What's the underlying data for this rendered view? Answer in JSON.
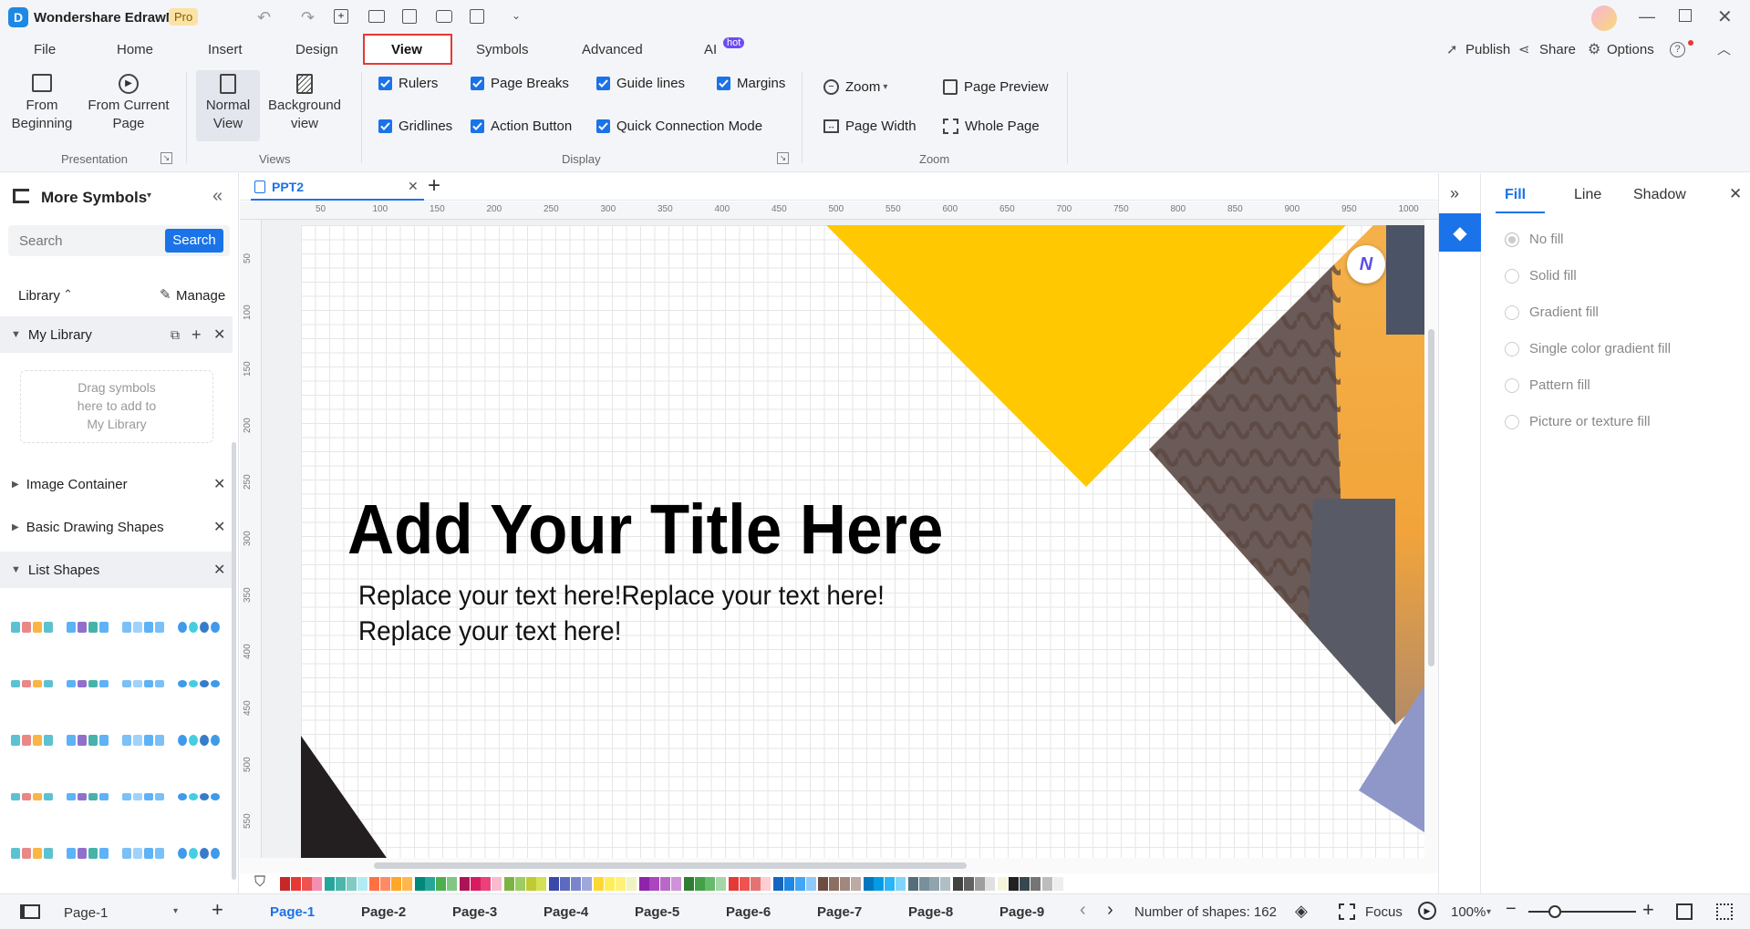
{
  "app": {
    "title": "Wondershare EdrawMax",
    "badge": "Pro"
  },
  "menu": {
    "tabs": [
      "File",
      "Home",
      "Insert",
      "Design",
      "View",
      "Symbols",
      "Advanced",
      "AI"
    ],
    "active": "View",
    "ai_badge": "hot",
    "right": {
      "publish": "Publish",
      "share": "Share",
      "options": "Options"
    }
  },
  "ribbon": {
    "presentation": {
      "from_beginning": [
        "From",
        "Beginning"
      ],
      "from_current": [
        "From Current",
        "Page"
      ],
      "label": "Presentation"
    },
    "views": {
      "normal": [
        "Normal",
        "View"
      ],
      "background": [
        "Background",
        "view"
      ],
      "label": "Views"
    },
    "display": {
      "rulers": "Rulers",
      "page_breaks": "Page Breaks",
      "guide_lines": "Guide lines",
      "margins": "Margins",
      "gridlines": "Gridlines",
      "action_button": "Action Button",
      "quick_connection": "Quick Connection Mode",
      "label": "Display"
    },
    "zoom": {
      "zoom": "Zoom",
      "page_width": "Page Width",
      "page_preview": "Page Preview",
      "whole_page": "Whole Page",
      "label": "Zoom"
    }
  },
  "left_panel": {
    "title": "More Symbols",
    "search_placeholder": "Search",
    "search_button": "Search",
    "library": "Library",
    "manage": "Manage",
    "my_library": "My Library",
    "drag_hint": [
      "Drag symbols",
      "here to add to",
      "My Library"
    ],
    "sections": [
      "Image Container",
      "Basic Drawing Shapes",
      "List Shapes"
    ]
  },
  "doc_tab": {
    "name": "PPT2"
  },
  "ruler": {
    "h": [
      "50",
      "100",
      "150",
      "200",
      "250",
      "300",
      "350",
      "400",
      "450",
      "500",
      "550",
      "600",
      "650",
      "700",
      "750",
      "800",
      "850",
      "900",
      "950",
      "1000"
    ],
    "v": [
      "50",
      "100",
      "150",
      "200",
      "250",
      "300",
      "350",
      "400",
      "450",
      "500",
      "550"
    ]
  },
  "slide": {
    "title": "Add Your Title Here",
    "body_line1": "Replace your text here!Replace your text here!",
    "body_line2": "Replace your text here!",
    "accent": "#ffc107"
  },
  "right_panel": {
    "tabs": [
      "Fill",
      "Line",
      "Shadow"
    ],
    "active": "Fill",
    "options": [
      "No fill",
      "Solid fill",
      "Gradient fill",
      "Single color gradient fill",
      "Pattern fill",
      "Picture or texture fill"
    ]
  },
  "status": {
    "page_select": "Page-1",
    "pages": [
      "Page-1",
      "Page-2",
      "Page-3",
      "Page-4",
      "Page-5",
      "Page-6",
      "Page-7",
      "Page-8",
      "Page-9"
    ],
    "shapes": "Number of shapes: 162",
    "focus": "Focus",
    "zoom": "100%"
  },
  "colors": {
    "accent": "#1a73e8",
    "highlight": "#e53935",
    "yellow": "#ffc800"
  }
}
